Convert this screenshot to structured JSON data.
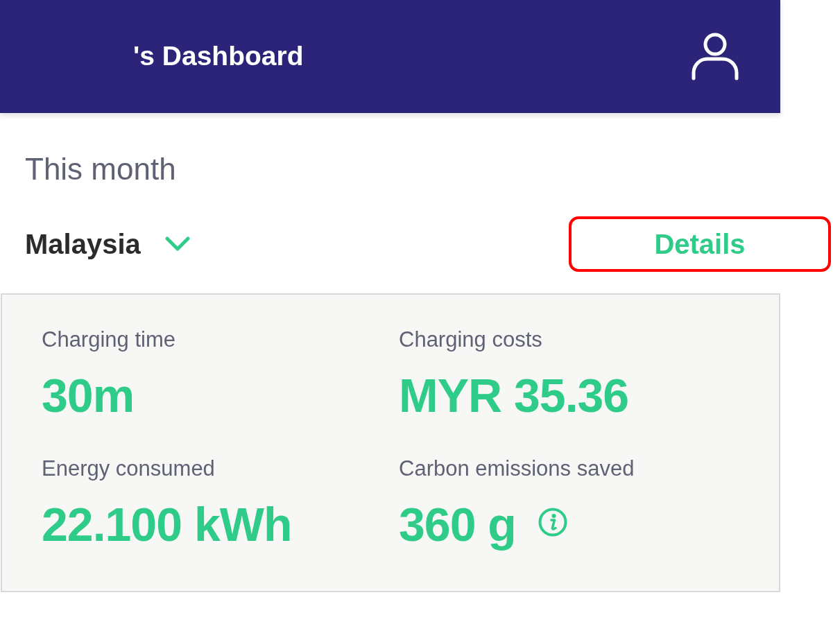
{
  "header": {
    "title": "'s Dashboard"
  },
  "period_title": "This month",
  "region_select": {
    "value": "Malaysia"
  },
  "details_button": {
    "label": "Details",
    "highlighted": true
  },
  "stats": [
    {
      "label": "Charging time",
      "value": "30m",
      "info": false
    },
    {
      "label": "Charging costs",
      "value": "MYR 35.36",
      "info": false
    },
    {
      "label": "Energy consumed",
      "value": "22.100 kWh",
      "info": false
    },
    {
      "label": "Carbon emissions saved",
      "value": "360 g",
      "info": true
    }
  ]
}
